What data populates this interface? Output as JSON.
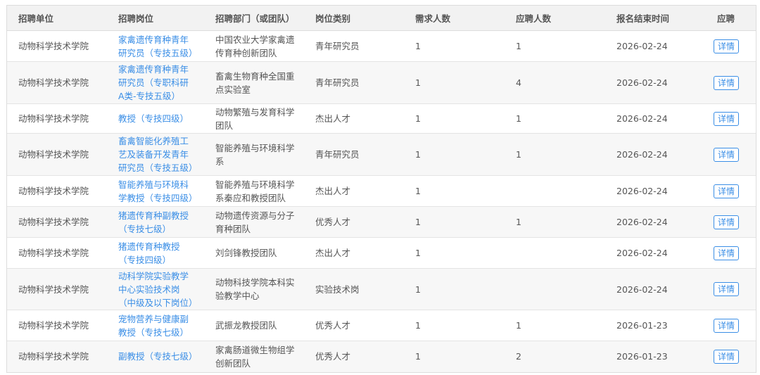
{
  "headers": [
    "招聘单位",
    "招聘岗位",
    "招聘部门（或团队）",
    "岗位类别",
    "需求人数",
    "应聘人数",
    "报名结束时间",
    "应聘"
  ],
  "rows": [
    {
      "unit": "动物科学技术学院",
      "position": "家禽遗传育种青年研究员（专技五级）",
      "dept": "中国农业大学家禽遗传育种创新团队",
      "category": "青年研究员",
      "needed": "1",
      "applicants": "1",
      "deadline": "2026-02-24",
      "action": "详情"
    },
    {
      "unit": "动物科学技术学院",
      "position": "家禽遗传育种青年研究员（专职科研A类-专技五级）",
      "dept": "畜禽生物育种全国重点实验室",
      "category": "青年研究员",
      "needed": "1",
      "applicants": "4",
      "deadline": "2026-02-24",
      "action": "详情"
    },
    {
      "unit": "动物科学技术学院",
      "position": "教授（专技四级）",
      "dept": "动物繁殖与发育科学团队",
      "category": "杰出人才",
      "needed": "1",
      "applicants": "1",
      "deadline": "2026-02-24",
      "action": "详情"
    },
    {
      "unit": "动物科学技术学院",
      "position": "畜禽智能化养殖工艺及装备开发青年研究员（专技五级）",
      "dept": "智能养殖与环境科学系",
      "category": "青年研究员",
      "needed": "1",
      "applicants": "1",
      "deadline": "2026-02-24",
      "action": "详情"
    },
    {
      "unit": "动物科学技术学院",
      "position": "智能养殖与环境科学教授（专技四级）",
      "dept": "智能养殖与环境科学系秦应和教授团队",
      "category": "杰出人才",
      "needed": "1",
      "applicants": "",
      "deadline": "2026-02-24",
      "action": "详情"
    },
    {
      "unit": "动物科学技术学院",
      "position": "猪遗传育种副教授（专技七级）",
      "dept": "动物遗传资源与分子育种团队",
      "category": "优秀人才",
      "needed": "1",
      "applicants": "1",
      "deadline": "2026-02-24",
      "action": "详情"
    },
    {
      "unit": "动物科学技术学院",
      "position": "猪遗传育种教授（专技四级）",
      "dept": "刘剑锋教授团队",
      "category": "杰出人才",
      "needed": "1",
      "applicants": "",
      "deadline": "2026-02-24",
      "action": "详情"
    },
    {
      "unit": "动物科学技术学院",
      "position": "动科学院实验教学中心实验技术岗（中级及以下岗位）",
      "dept": "动物科技学院本科实验教学中心",
      "category": "实验技术岗",
      "needed": "1",
      "applicants": "",
      "deadline": "2026-02-24",
      "action": "详情"
    },
    {
      "unit": "动物科学技术学院",
      "position": "宠物营养与健康副教授（专技七级）",
      "dept": "武振龙教授团队",
      "category": "优秀人才",
      "needed": "1",
      "applicants": "1",
      "deadline": "2026-01-23",
      "action": "详情"
    },
    {
      "unit": "动物科学技术学院",
      "position": "副教授（专技七级）",
      "dept": "家禽肠道微生物组学创新团队",
      "category": "优秀人才",
      "needed": "1",
      "applicants": "2",
      "deadline": "2026-01-23",
      "action": "详情"
    }
  ]
}
